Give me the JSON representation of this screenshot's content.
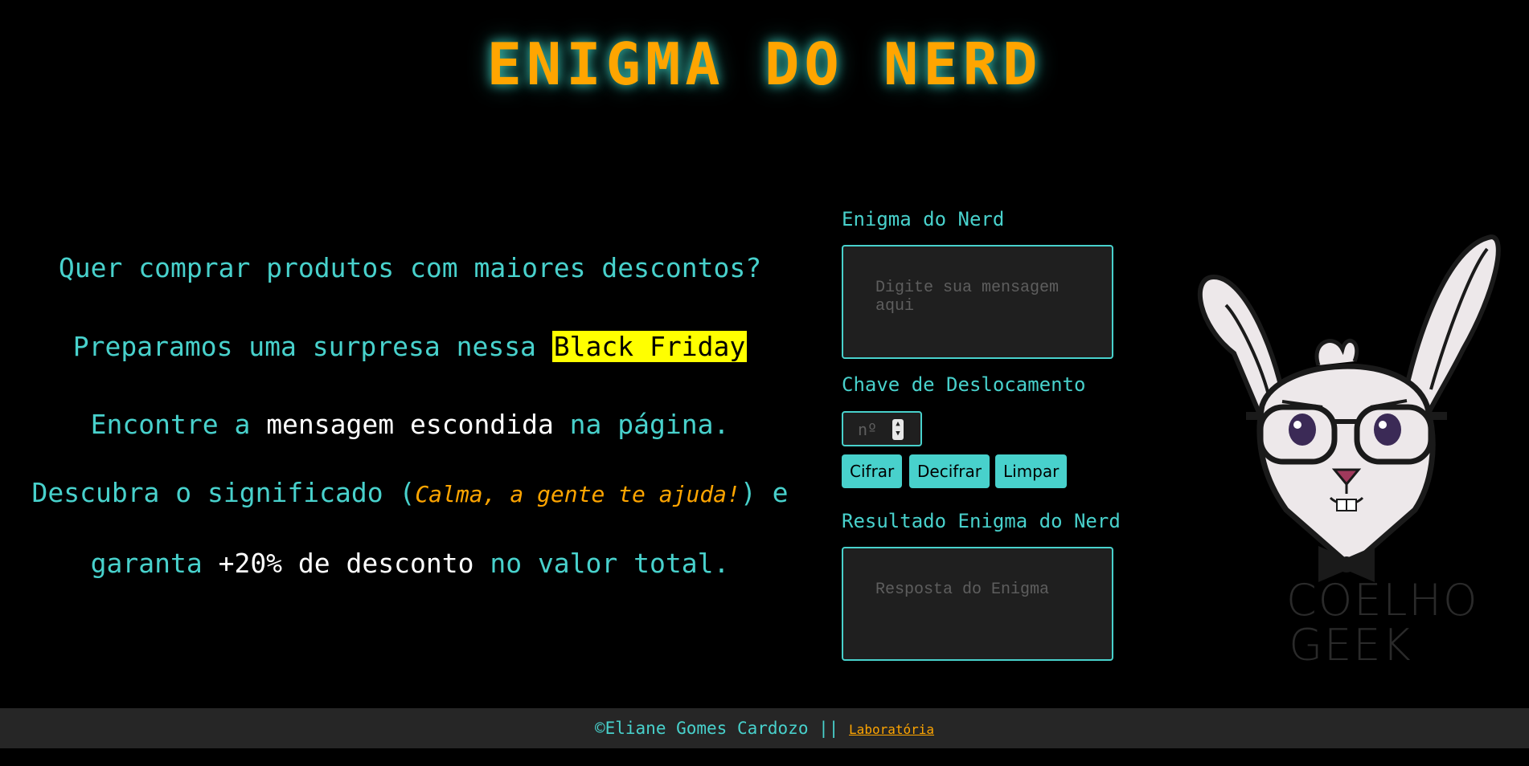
{
  "header": {
    "title": "ENIGMA DO NERD"
  },
  "intro": {
    "line1": "Quer comprar produtos com maiores descontos?",
    "line2_a": "Preparamos uma surpresa nessa ",
    "line2_highlight": "Black Friday",
    "line3_a": "Encontre a ",
    "line3_b": "mensagem escondida",
    "line3_c": " na página.",
    "line4_a": "Descubra o significado (",
    "line4_b": "Calma, a gente te ajuda!",
    "line4_c": ") e",
    "line5_a": "garanta ",
    "line5_b": "+20% de desconto",
    "line5_c": " no valor total."
  },
  "form": {
    "message_label": "Enigma do Nerd",
    "message_placeholder": "Digite sua mensagem aqui",
    "message_value": "",
    "key_label": "Chave de Deslocamento",
    "key_placeholder": "nº",
    "key_value": "",
    "buttons": {
      "encrypt": "Cifrar",
      "decrypt": "Decifrar",
      "clear": "Limpar"
    },
    "result_label": "Resultado Enigma do Nerd",
    "result_placeholder": "Resposta do Enigma",
    "result_value": ""
  },
  "mascot": {
    "icon": "rabbit-mascot-icon",
    "caption_line1": "COELHO",
    "caption_line2": "GEEK"
  },
  "footer": {
    "copyright": "©Eliane Gomes Cardozo || ",
    "link_label": "Laboratória"
  },
  "colors": {
    "background": "#000000",
    "accent": "#48d1cc",
    "title": "#ffa500",
    "highlight": "#ffff00",
    "footer_bg": "#262626"
  }
}
